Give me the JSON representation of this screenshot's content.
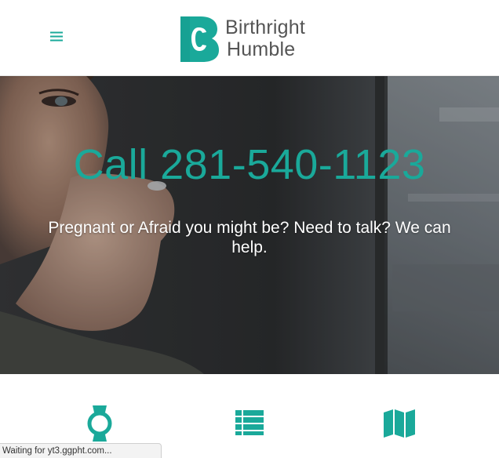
{
  "header": {
    "menu_icon": "hamburger-menu-icon",
    "logo_icon": "birthright-b-logo-icon",
    "logo_line1": "Birthright",
    "logo_line2": "Humble"
  },
  "hero": {
    "title": "Call 281-540-1123",
    "subtitle": "Pregnant or Afraid you might be? Need to talk? We can help."
  },
  "features": {
    "icons": [
      "watch-icon",
      "list-icon",
      "map-icon"
    ]
  },
  "status_bar": {
    "text": "Waiting for yt3.ggpht.com..."
  },
  "colors": {
    "accent": "#1aa99a",
    "logo_text": "#555555",
    "hero_text": "#ffffff"
  }
}
